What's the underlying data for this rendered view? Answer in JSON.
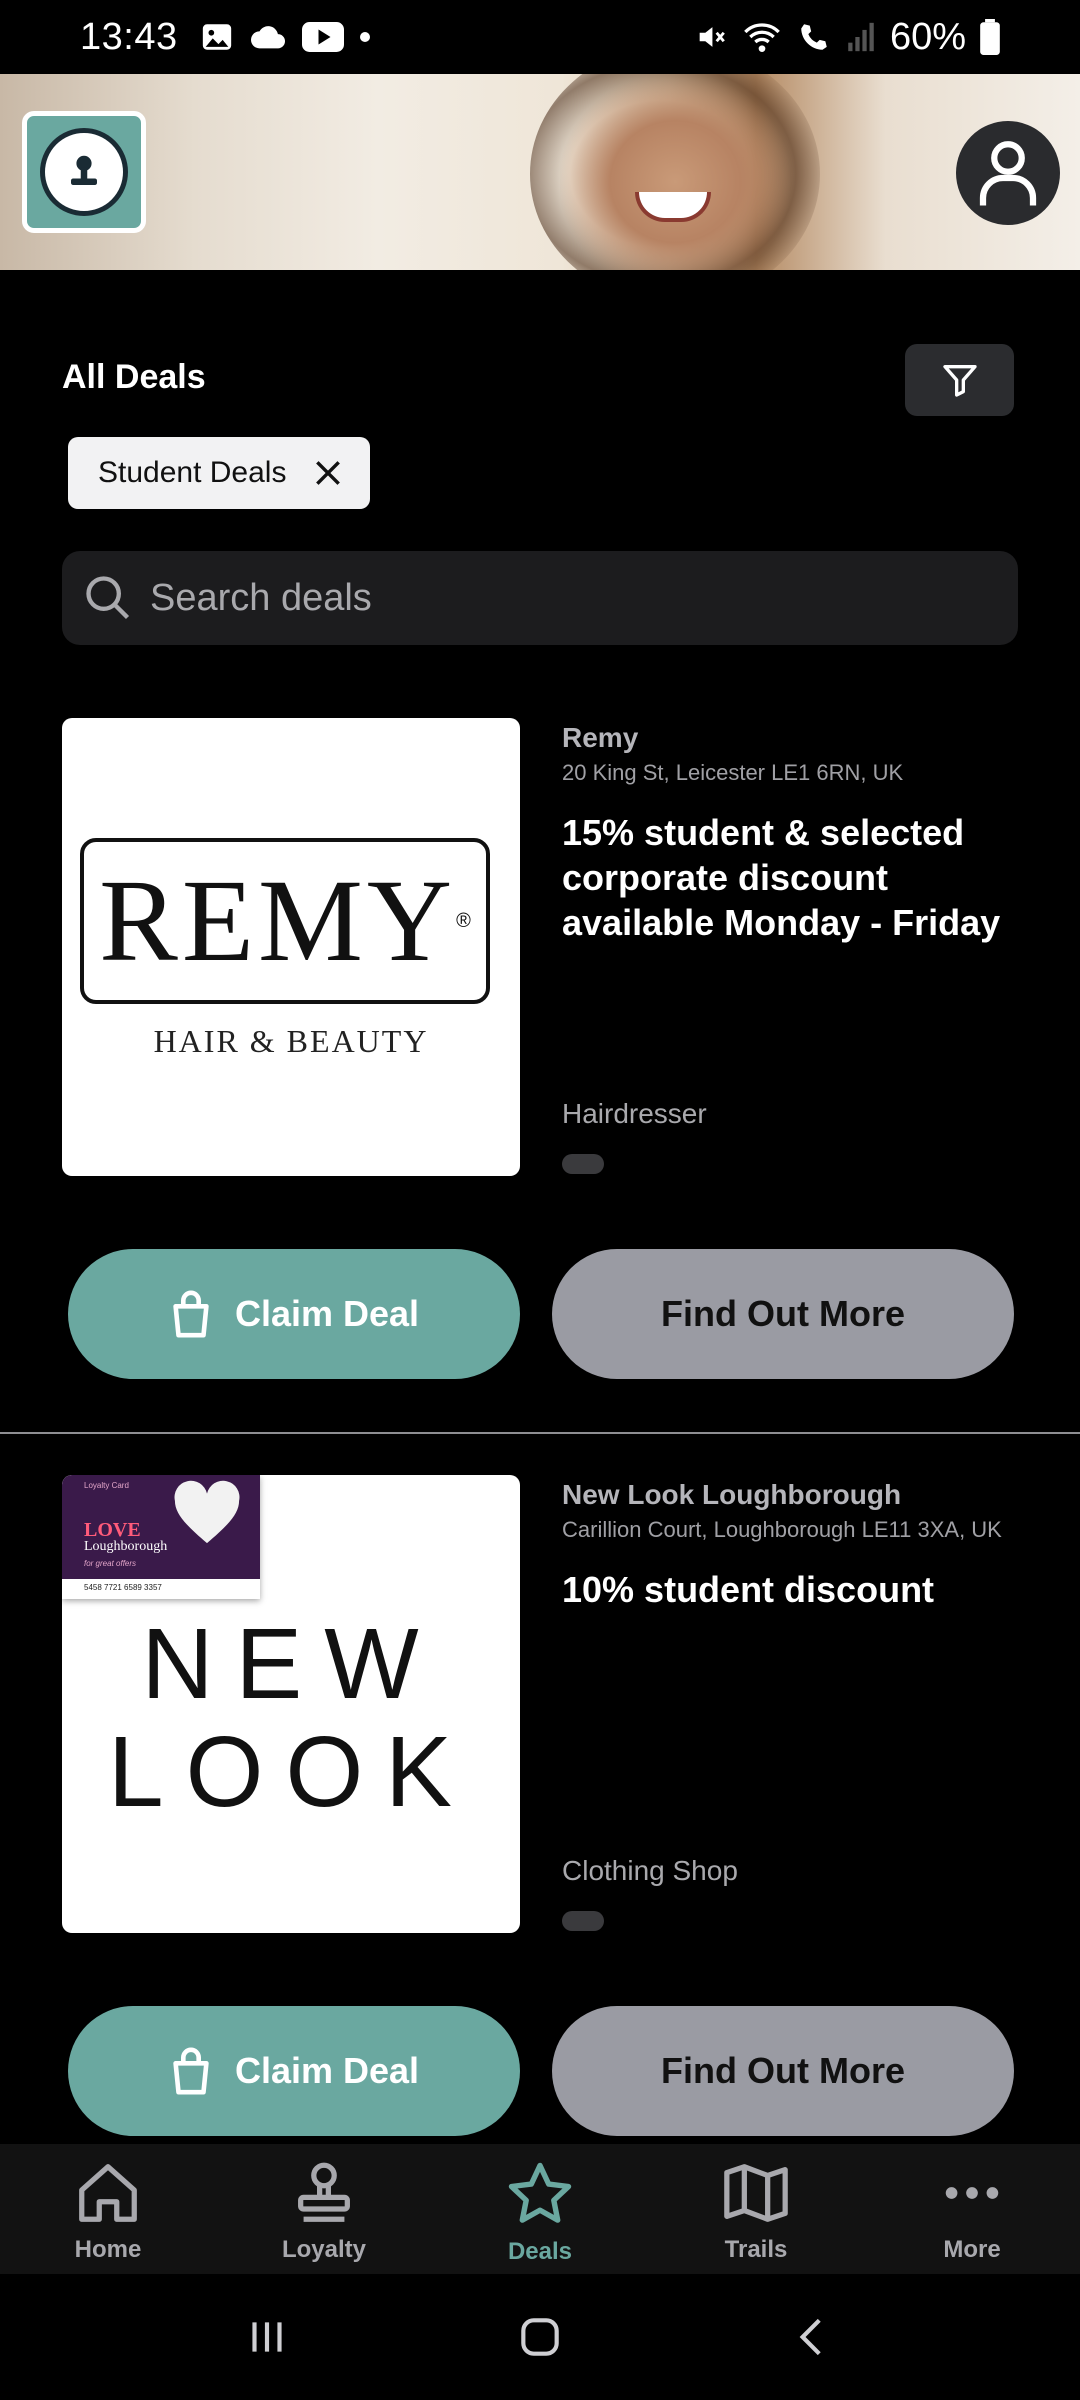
{
  "status_bar": {
    "time": "13:43",
    "battery": "60%"
  },
  "header": {
    "section_title": "All Deals",
    "active_filter_chip": "Student Deals",
    "search_placeholder": "Search deals"
  },
  "deals": [
    {
      "merchant": "Remy",
      "address": "20 King St, Leicester LE1 6RN, UK",
      "offer": "15% student & selected corporate discount available Monday - Friday",
      "category": "Hairdresser",
      "logo_text": "REMY",
      "logo_reg": "®",
      "logo_subtext": "HAIR & BEAUTY",
      "claim_label": "Claim Deal",
      "more_label": "Find Out More"
    },
    {
      "merchant": "New Look Loughborough",
      "address": "Carillion Court, Loughborough LE11 3XA, UK",
      "offer": "10% student discount",
      "category": "Clothing Shop",
      "logo_line1": "NEW",
      "logo_line2": "LOOK",
      "card_small": "Loyalty Card",
      "card_love": "LOVE",
      "card_town": "Loughborough",
      "card_tagline": "for great offers",
      "card_number": "5458 7721 6589 3357",
      "claim_label": "Claim Deal",
      "more_label": "Find Out More"
    }
  ],
  "bottom_nav": [
    {
      "label": "Home",
      "icon": "home-icon"
    },
    {
      "label": "Loyalty",
      "icon": "stamp-icon"
    },
    {
      "label": "Deals",
      "icon": "star-icon",
      "active": true
    },
    {
      "label": "Trails",
      "icon": "map-icon"
    },
    {
      "label": "More",
      "icon": "more-icon"
    }
  ],
  "colors": {
    "accent": "#6aa8a0",
    "secondary_button": "#9a9ba3",
    "background": "#000000"
  }
}
